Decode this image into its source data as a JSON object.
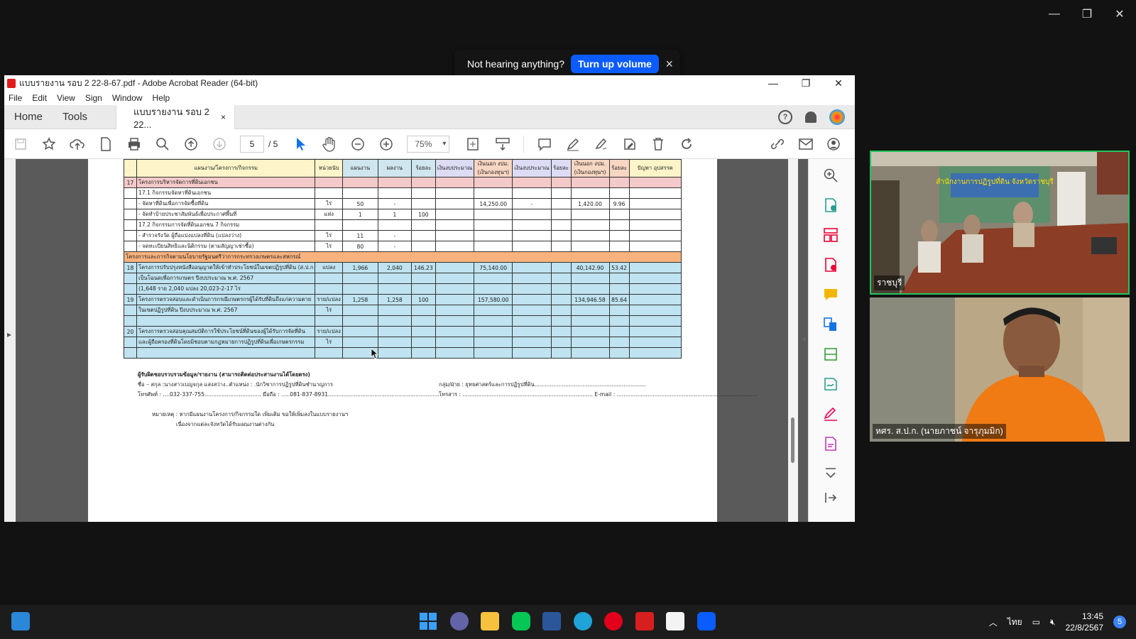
{
  "zoom_notification": {
    "text": "Not hearing anything?",
    "button": "Turn up volume",
    "close": "×"
  },
  "outer_window": {
    "minimize": "—",
    "maximize": "❐",
    "close": "✕"
  },
  "acrobat": {
    "title": "แบบรายงาน รอบ 2 22-8-67.pdf - Adobe Acrobat Reader (64-bit)",
    "window_controls": {
      "minimize": "—",
      "maximize": "❐",
      "close": "✕"
    },
    "menu": [
      "File",
      "Edit",
      "View",
      "Sign",
      "Window",
      "Help"
    ],
    "tabs": {
      "home": "Home",
      "tools": "Tools",
      "doc_tab": "แบบรายงาน รอบ 2 22...",
      "doc_close": "×"
    },
    "help": "?",
    "page_current": "5",
    "page_total": "/ 5",
    "zoom": "75%"
  },
  "report": {
    "header": [
      "",
      "แผนงาน/โครงการ/กิจกรรม",
      "หน่วยนับ",
      "แผนงาน",
      "ผลงาน",
      "ร้อยละ",
      "เงินงบประมาณ",
      "เงินนอก งปม. (เงินกองทุนฯ)",
      "เงินงบประมาณ",
      "ร้อยละ",
      "เงินนอก งปม. (เงินกองทุนฯ)",
      "ร้อยละ",
      "ปัญหา อุปสรรค"
    ],
    "rows": [
      {
        "cls": "sec",
        "cells": [
          "17",
          "โครงการบริหารจัดการที่ดินเอกชน",
          "",
          "",
          "",
          "",
          "",
          "",
          "",
          "",
          "",
          "",
          ""
        ]
      },
      {
        "cls": "",
        "cells": [
          "",
          "      17.1 กิจกรรมจัดหาที่ดินเอกชน",
          "",
          "",
          "",
          "",
          "",
          "",
          "",
          "",
          "",
          "",
          ""
        ]
      },
      {
        "cls": "",
        "cells": [
          "",
          "          - จัดหาที่ดินเพื่อการจัดซื้อที่ดิน",
          "ไร่",
          "50",
          "-",
          "",
          "",
          "14,250.00",
          "-",
          "",
          "1,420.00",
          "9.96",
          ""
        ]
      },
      {
        "cls": "",
        "cells": [
          "",
          "          - จัดทำป้ายประชาสัมพันธ์เพื่อประกาศพื้นที่",
          "แห่ง",
          "1",
          "1",
          "100",
          "",
          "",
          "",
          "",
          "",
          "",
          ""
        ]
      },
      {
        "cls": "",
        "cells": [
          "",
          "      17.2 กิจกรรมการจัดที่ดินเอกชน 7 กิจกรรม",
          "",
          "",
          "",
          "",
          "",
          "",
          "",
          "",
          "",
          "",
          ""
        ]
      },
      {
        "cls": "",
        "cells": [
          "",
          "          - สำรวจรังวัด ผู้ถือแบ่งแปลงที่ดิน (แปลงว่าง)",
          "ไร่",
          "11",
          "-",
          "",
          "",
          "",
          "",
          "",
          "",
          "",
          ""
        ]
      },
      {
        "cls": "",
        "cells": [
          "",
          "          - จดทะเบียนสิทธิและนิติกรรม (ตามสัญญาเช่าซื้อ)",
          "ไร่",
          "80",
          "-",
          "",
          "",
          "",
          "",
          "",
          "",
          "",
          ""
        ]
      },
      {
        "cls": "org",
        "cells": [
          "โครงการและภารกิจตามนโยบายรัฐมนตรีว่าการกระทรวงเกษตรและสหกรณ์",
          "",
          "",
          "",
          "",
          "",
          "",
          "",
          "",
          "",
          "",
          "",
          ""
        ]
      },
      {
        "cls": "blue",
        "cells": [
          "18",
          "โครงการปรับปรุงหนังสืออนุญาตให้เข้าทำประโยชน์ในเขตปฏิรูปที่ดิน (ส.ป.ก",
          "แปลง",
          "1,966",
          "2,040",
          "146.23",
          "",
          "75,140.00",
          "",
          "",
          "40,142.90",
          "53.42",
          ""
        ]
      },
      {
        "cls": "blue",
        "cells": [
          "",
          "เป็นโฉนดเพื่อการเกษตร ปีงบประมาณ พ.ศ. 2567",
          "",
          "",
          "",
          "",
          "",
          "",
          "",
          "",
          "",
          "",
          ""
        ]
      },
      {
        "cls": "blue",
        "cells": [
          "",
          "(1,648 ราย 2,040 แปลง 20,023-2-17 ไร่",
          "",
          "",
          "",
          "",
          "",
          "",
          "",
          "",
          "",
          "",
          ""
        ]
      },
      {
        "cls": "blue",
        "cells": [
          "19",
          "โครงการตรวจสอบและดำเนินการกรณีเกษตรกรผู้ได้รับที่ดินถึงแก่ความตาย",
          "ราย/แปลง",
          "1,258",
          "1,258",
          "100",
          "",
          "157,580.00",
          "",
          "",
          "134,946.58",
          "85.64",
          ""
        ]
      },
      {
        "cls": "blue",
        "cells": [
          "",
          "ในเขตปฏิรูปที่ดิน ปีงบประมาณ พ.ศ. 2567",
          "ไร่",
          "",
          "",
          "",
          "",
          "",
          "",
          "",
          "",
          "",
          ""
        ]
      },
      {
        "cls": "blue",
        "cells": [
          "",
          "",
          "",
          "",
          "",
          "",
          "",
          "",
          "",
          "",
          "",
          "",
          ""
        ]
      },
      {
        "cls": "blue",
        "cells": [
          "20",
          "โครงการตรวจสอบคุณสมบัติการใช้ประโยชน์ที่ดินของผู้ได้รับการจัดที่ดิน",
          "ราย/แปลง",
          "",
          "",
          "",
          "",
          "",
          "",
          "",
          "",
          "",
          ""
        ]
      },
      {
        "cls": "blue",
        "cells": [
          "",
          "และผู้ถือครองที่ดินโดยมิชอบตามกฎหมายการปฏิรูปที่ดินเพื่อเกษตรกรรม",
          "ไร่",
          "",
          "",
          "",
          "",
          "",
          "",
          "",
          "",
          "",
          ""
        ]
      },
      {
        "cls": "blue",
        "cells": [
          "",
          "",
          "",
          "",
          "",
          "",
          "",
          "",
          "",
          "",
          "",
          "",
          ""
        ]
      }
    ],
    "footer": {
      "heading": "ผู้รับผิดชอบรวบรวมข้อมูล/รายงาน  (สามารถติดต่อประสานงานได้โดยตรง)",
      "name": "ชื่อ – สกุล :นางสาวเบญจกุล แสงสว่าง..ตำแหน่ง : .นักวิชาการปฏิรูปที่ดินชำนาญการ",
      "group": "กลุ่ม/ฝ่าย : ยุทธศาสตร์และการปฏิรูปที่ดิน.................................................................",
      "phone": "โทรศัพท์ : ....032-337-755.................................   มือถือ : .....081-837-8931.................................................................",
      "fax": "โทรสาร : ............................................................................ E-mail : ..................................................................................",
      "note": "หมายเหตุ : หากมีแผนงานโครงการ/กิจกรรมใด เพิ่มเติม ขอให้เพิ่มลงในแบบรายงานฯ",
      "note2": "เนื่องจากแต่ละจังหวัดได้รับแผนงานต่างกัน"
    }
  },
  "video": {
    "tile1_label": "ราชบุรี",
    "tile1_poster": "สำนักงานการปฏิรูปที่ดิน จังหวัดราชบุรี",
    "tile2_label": "หศร. ส.ป.ก. (นายภาชน์ จารุภุมมิก)"
  },
  "taskbar": {
    "language": "ไทย",
    "time": "13:45",
    "date": "22/8/2567",
    "notification_count": "5"
  },
  "colors": {
    "zoom_blue": "#0b5cff",
    "active_speaker": "#22c55e",
    "acrobat_red": "#e21b1b",
    "table_blue": "#bfe3f0",
    "table_orange": "#f7b27d",
    "table_pink": "#f4c9c9"
  }
}
